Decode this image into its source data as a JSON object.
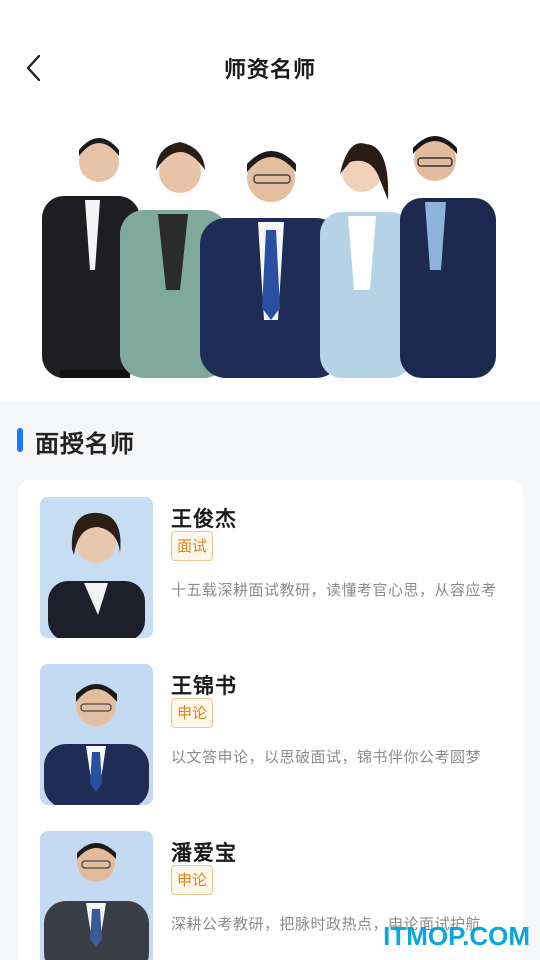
{
  "header": {
    "title": "师资名师",
    "back_icon": "chevron-left-icon"
  },
  "section": {
    "title": "面授名师",
    "accent_color": "#1677ff"
  },
  "teachers": [
    {
      "name": "王俊杰",
      "tag": "面试",
      "desc": "十五载深耕面试教研，读懂考官心思，从容应考"
    },
    {
      "name": "王锦书",
      "tag": "申论",
      "desc": "以文答申论，以思破面试，锦书伴你公考圆梦"
    },
    {
      "name": "潘爱宝",
      "tag": "申论",
      "desc": "深耕公考教研，把脉时政热点，申论面试护航"
    }
  ],
  "watermark": "ITMOP.COM"
}
